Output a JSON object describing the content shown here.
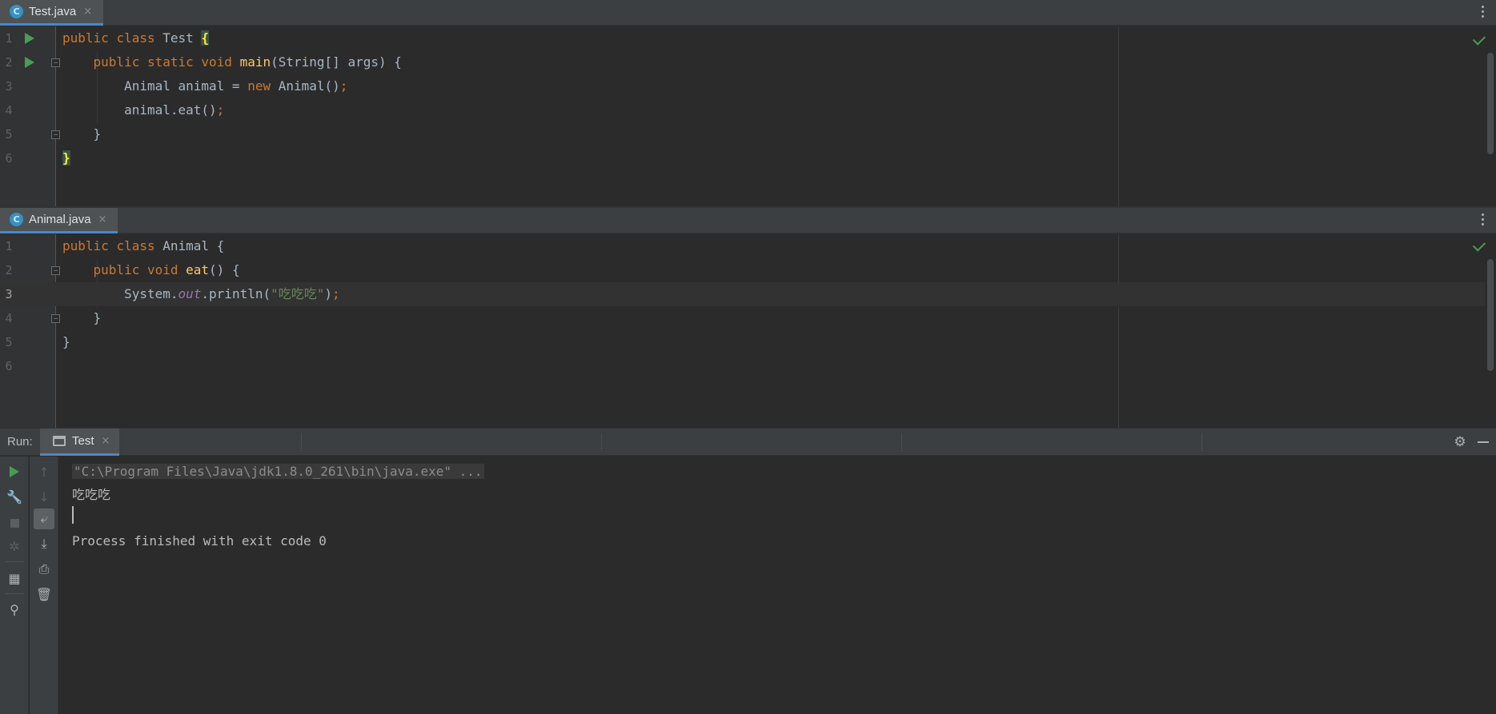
{
  "editors": [
    {
      "tab": {
        "label": "Test.java",
        "icon": "java-class-icon",
        "icon_glyph": "C",
        "close": "×"
      },
      "lines": [
        {
          "n": "1",
          "tokens": [
            [
              "kw",
              "public "
            ],
            [
              "kw",
              "class "
            ],
            [
              "plain",
              "Test "
            ],
            [
              "brace",
              "{"
            ]
          ]
        },
        {
          "n": "2",
          "tokens": [
            [
              "plain",
              "    "
            ],
            [
              "kw",
              "public "
            ],
            [
              "kw",
              "static "
            ],
            [
              "kw",
              "void "
            ],
            [
              "fn",
              "main"
            ],
            [
              "plain",
              "(String[] args) {"
            ]
          ]
        },
        {
          "n": "3",
          "tokens": [
            [
              "plain",
              "        Animal animal = "
            ],
            [
              "kw",
              "new "
            ],
            [
              "plain",
              "Animal()"
            ],
            [
              "kw",
              ";"
            ]
          ]
        },
        {
          "n": "4",
          "tokens": [
            [
              "plain",
              "        animal.eat()"
            ],
            [
              "kw",
              ";"
            ]
          ]
        },
        {
          "n": "5",
          "tokens": [
            [
              "plain",
              "    }"
            ]
          ]
        },
        {
          "n": "6",
          "tokens": [
            [
              "brace",
              "}"
            ]
          ]
        }
      ]
    },
    {
      "tab": {
        "label": "Animal.java",
        "icon": "java-class-icon",
        "icon_glyph": "C",
        "close": "×"
      },
      "lines": [
        {
          "n": "1",
          "tokens": [
            [
              "kw",
              "public "
            ],
            [
              "kw",
              "class "
            ],
            [
              "plain",
              "Animal {"
            ]
          ]
        },
        {
          "n": "2",
          "tokens": [
            [
              "plain",
              "    "
            ],
            [
              "kw",
              "public "
            ],
            [
              "kw",
              "void "
            ],
            [
              "fn",
              "eat"
            ],
            [
              "plain",
              "() {"
            ]
          ]
        },
        {
          "n": "3",
          "tokens": [
            [
              "plain",
              "        System."
            ],
            [
              "fld",
              "out"
            ],
            [
              "plain",
              ".println("
            ],
            [
              "str",
              "\"吃吃吃\""
            ],
            [
              "plain",
              ")"
            ],
            [
              "kw",
              ";"
            ]
          ]
        },
        {
          "n": "4",
          "tokens": [
            [
              "plain",
              "    }"
            ]
          ]
        },
        {
          "n": "5",
          "tokens": [
            [
              "plain",
              "}"
            ]
          ]
        },
        {
          "n": "6",
          "tokens": []
        }
      ]
    }
  ],
  "run": {
    "title": "Run:",
    "tab_label": "Test",
    "tab_close": "×",
    "gear_glyph": "⚙",
    "console": {
      "command": "\"C:\\Program Files\\Java\\jdk1.8.0_261\\bin\\java.exe\" ...",
      "output": "吃吃吃",
      "exit": "Process finished with exit code 0"
    },
    "left_toolbar": [
      {
        "name": "rerun-icon",
        "glyph": ""
      },
      {
        "name": "wrench-icon",
        "glyph": "🔧"
      },
      {
        "name": "stop-icon",
        "glyph": ""
      },
      {
        "name": "debug-bug-icon",
        "glyph": "✲"
      },
      {
        "name": "layout-icon",
        "glyph": "▦"
      },
      {
        "name": "pin-icon",
        "glyph": "⚲"
      }
    ],
    "right_toolbar": [
      {
        "name": "up-arrow-icon",
        "glyph": "↑"
      },
      {
        "name": "down-arrow-icon",
        "glyph": "↓"
      },
      {
        "name": "soft-wrap-icon",
        "glyph": "⤶"
      },
      {
        "name": "scroll-to-end-icon",
        "glyph": "⤓"
      },
      {
        "name": "print-icon",
        "glyph": "⎙"
      },
      {
        "name": "trash-icon",
        "glyph": "🗑"
      }
    ]
  },
  "colors": {
    "keyword": "#cc7832",
    "function": "#ffc66d",
    "string": "#6a8759",
    "field": "#9876aa",
    "background": "#2b2b2b",
    "run_green": "#499c54"
  }
}
